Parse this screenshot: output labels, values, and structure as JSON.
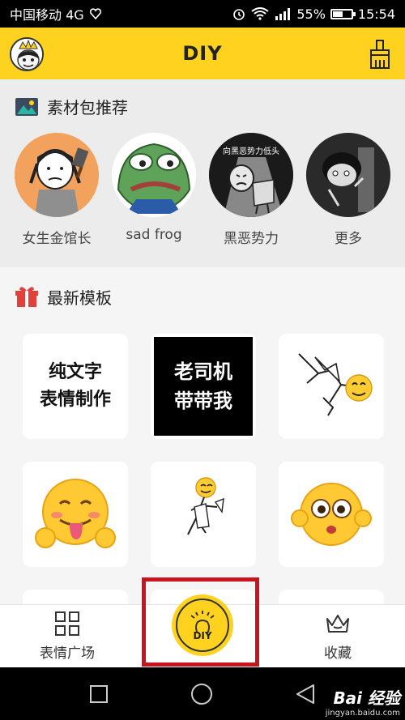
{
  "status_bar": {
    "carrier": "中国移动 4G",
    "battery": "55%",
    "battery_level": 0.55,
    "time": "15:54",
    "icons": [
      "signal-heart-icon",
      "alarm-icon",
      "wifi-icon",
      "cell-signal-icon",
      "battery-icon"
    ]
  },
  "header": {
    "title": "DIY",
    "left_icon": "avatar-icon",
    "right_icon": "brush-icon",
    "background": "#ffd21f"
  },
  "packs": {
    "title": "素材包推荐",
    "icon": "image-pack-icon",
    "items": [
      {
        "label": "女生金馆长",
        "icon": "girl-cleaver-meme-icon"
      },
      {
        "label": "sad frog",
        "icon": "sad-frog-icon"
      },
      {
        "label": "黑恶势力",
        "icon": "dark-forces-meme-icon",
        "caption": "向黑恶势力低头"
      },
      {
        "label": "更多",
        "icon": "more-meme-icon"
      }
    ]
  },
  "templates": {
    "title": "最新模板",
    "icon": "gift-icon",
    "tiles": [
      {
        "text": "纯文字\n表情制作",
        "kind": "text"
      },
      {
        "text": "老司机\n带带我",
        "kind": "black-text"
      },
      {
        "kind": "stickman-kick-icon"
      },
      {
        "kind": "tongue-emoji-icon"
      },
      {
        "kind": "stickman-emoji-icon"
      },
      {
        "kind": "shocked-emoji-icon"
      }
    ]
  },
  "tab_bar": {
    "left": {
      "label": "表情广场",
      "icon": "grid-icon"
    },
    "center": {
      "label": "DIY",
      "icon": "lightbulb-icon"
    },
    "right": {
      "label": "收藏",
      "icon": "crown-icon"
    }
  },
  "nav_bar": {
    "icons": [
      "square-icon",
      "circle-icon",
      "back-triangle-icon"
    ]
  },
  "watermark": {
    "main": "Bai 经验",
    "sub": "jingyan.baidu.com"
  },
  "colors": {
    "accent": "#ffd21f",
    "highlight": "#c8141e"
  }
}
